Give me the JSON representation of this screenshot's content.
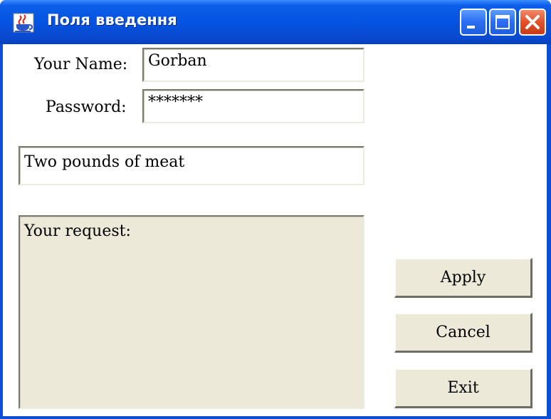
{
  "window": {
    "title": "Поля введення",
    "title_bar_color": "#0553e0",
    "icon": "java-cup-icon",
    "controls": {
      "minimize_icon": "minimize-icon",
      "maximize_icon": "maximize-icon",
      "close_icon": "close-icon"
    }
  },
  "form": {
    "name_label": "Your Name:",
    "name_value": "Gorban",
    "password_label": "Password:",
    "password_value": "*******",
    "text_field_value": "Two pounds of meat",
    "request_area_text": "Your request:"
  },
  "buttons": {
    "apply_label": "Apply",
    "cancel_label": "Cancel",
    "exit_label": "Exit"
  },
  "colors": {
    "panel_background": "#ece9d8",
    "client_background": "#ffffff",
    "close_button": "#e2512c"
  }
}
